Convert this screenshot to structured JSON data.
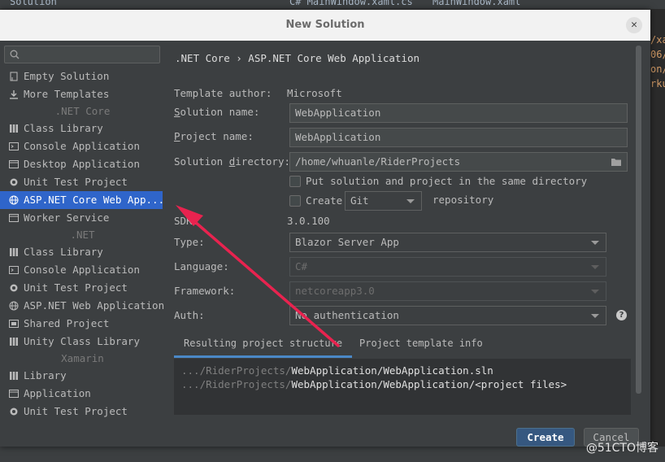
{
  "ide": {
    "tabs": [
      "Solution",
      "C# MainWindow.xaml.cs",
      "MainWindow.xaml"
    ],
    "right_edge_text": [
      "/xa",
      "06/",
      "on/",
      "rku"
    ],
    "watermark": "@51CTO博客"
  },
  "dialog": {
    "title": "New Solution",
    "close_label": "✕"
  },
  "sidebar": {
    "search_placeholder": "",
    "items_top": [
      {
        "label": "Empty Solution",
        "icon": "empty-solution-icon"
      },
      {
        "label": "More Templates",
        "icon": "download-icon"
      }
    ],
    "netcore_header": ".NET Core",
    "netcore_items": [
      {
        "label": "Class Library",
        "icon": "library-icon"
      },
      {
        "label": "Console Application",
        "icon": "console-icon"
      },
      {
        "label": "Desktop Application",
        "icon": "desktop-icon"
      },
      {
        "label": "Unit Test Project",
        "icon": "unit-test-icon"
      },
      {
        "label": "ASP.NET Core Web App...",
        "icon": "globe-icon",
        "selected": true
      },
      {
        "label": "Worker Service",
        "icon": "window-icon"
      }
    ],
    "net_header": ".NET",
    "net_items": [
      {
        "label": "Class Library",
        "icon": "library-icon"
      },
      {
        "label": "Console Application",
        "icon": "console-icon"
      },
      {
        "label": "Unit Test Project",
        "icon": "unit-test-icon"
      },
      {
        "label": "ASP.NET Web Application",
        "icon": "globe-icon"
      },
      {
        "label": "Shared Project",
        "icon": "shared-icon"
      },
      {
        "label": "Unity Class Library",
        "icon": "library-icon"
      }
    ],
    "xamarin_header": "Xamarin",
    "xamarin_items": [
      {
        "label": "Library",
        "icon": "library-icon"
      },
      {
        "label": "Application",
        "icon": "app-icon"
      },
      {
        "label": "Unit Test Project",
        "icon": "unit-test-icon"
      }
    ]
  },
  "main": {
    "breadcrumb": ".NET Core › ASP.NET Core Web Application",
    "template_author_label": "Template author:",
    "template_author_value": "Microsoft",
    "solution_name_label_u": "S",
    "solution_name_label_rest": "olution name:",
    "solution_name_value": "WebApplication",
    "project_name_label_u": "P",
    "project_name_label_rest": "roject name:",
    "project_name_value": "WebApplication",
    "solution_dir_label_pre": "Solution ",
    "solution_dir_label_u": "d",
    "solution_dir_label_rest": "irectory:",
    "solution_dir_value": "/home/whuanle/RiderProjects",
    "same_dir_label": "Put solution and project in the same directory",
    "create_label": "Create",
    "vcs_value": "Git",
    "repository_label": "repository",
    "sdk_label": "SDK:",
    "sdk_value": "3.0.100",
    "type_label": "Type:",
    "type_value": "Blazor Server App",
    "language_label": "Language:",
    "language_value": "C#",
    "framework_label": "Framework:",
    "framework_value": "netcoreapp3.0",
    "auth_label": "Auth:",
    "auth_value": "No authentication",
    "help_label": "?",
    "tabs": [
      "Resulting project structure",
      "Project template info"
    ],
    "structure_line1_dim": ".../RiderProjects/",
    "structure_line1": "WebApplication/WebApplication.sln",
    "structure_line2_dim": ".../RiderProjects/",
    "structure_line2": "WebApplication/WebApplication/<project files>",
    "create_button": "Create",
    "cancel_button": "Cancel"
  },
  "colors": {
    "selection": "#2f65ca",
    "annotation_arrow": "#e8234f",
    "primary_button": "#365880"
  }
}
